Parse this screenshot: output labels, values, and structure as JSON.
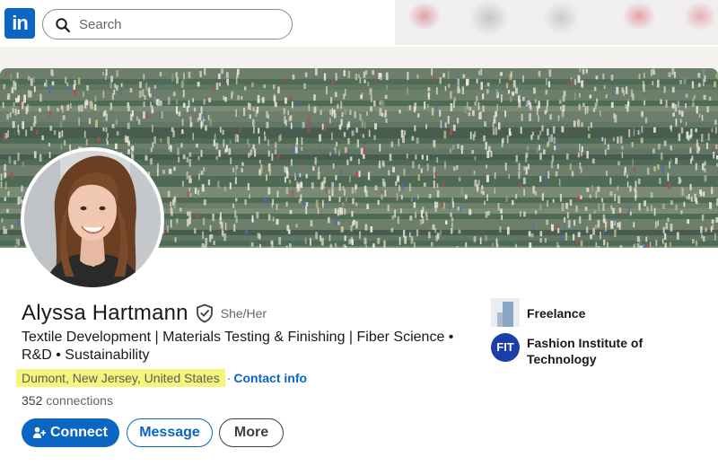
{
  "nav": {
    "logo_text": "in",
    "search": {
      "placeholder": "Search"
    }
  },
  "profile": {
    "name": "Alyssa Hartmann",
    "pronouns": "She/Her",
    "headline": "Textile Development | Materials Testing & Finishing | Fiber Science • R&D • Sustainability",
    "location": "Dumont, New Jersey, United States",
    "separator": "·",
    "contact_info_label": "Contact info",
    "connections_count": "352",
    "connections_label": "connections",
    "buttons": {
      "connect": "Connect",
      "message": "Message",
      "more": "More"
    },
    "experience": {
      "current_company": "Freelance"
    },
    "education": {
      "school": "Fashion Institute of Technology",
      "logo_text": "FIT"
    }
  },
  "colors": {
    "brand": "#0a66c2",
    "location_highlight": "#f4f57a",
    "school_logo": "#1b3fa8"
  },
  "icons": [
    "linkedin-logo",
    "search-icon",
    "verified-shield-icon",
    "connect-person-plus-icon"
  ]
}
